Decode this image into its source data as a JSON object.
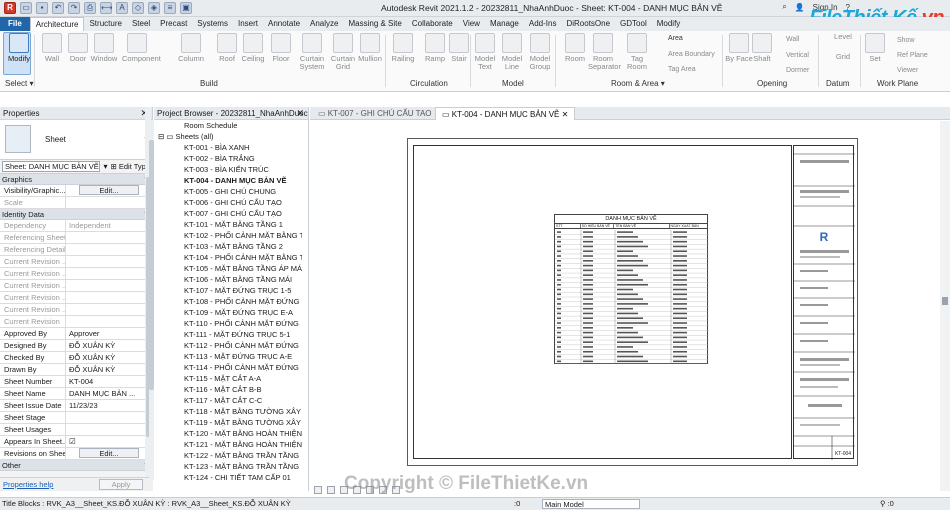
{
  "titlebar": {
    "title": "Autodesk Revit 2021.1.2 - 20232811_NhaAnhDuoc - Sheet: KT-004 - DANH MỤC BẢN VẼ",
    "sign_in": "Sign In",
    "help": "?",
    "logo_text": "File",
    "logo_text2": "Thiết Kế",
    "logo_dot": ".vn"
  },
  "tabs": [
    "File",
    "Architecture",
    "Structure",
    "Steel",
    "Precast",
    "Systems",
    "Insert",
    "Annotate",
    "Analyze",
    "Massing & Site",
    "Collaborate",
    "View",
    "Manage",
    "Add-Ins",
    "DiRootsOne",
    "GDTool",
    "Modify"
  ],
  "ribbon": {
    "tools": [
      {
        "label": "Modify",
        "selected": true
      },
      {
        "label": "Wall"
      },
      {
        "label": "Door"
      },
      {
        "label": "Window"
      },
      {
        "label": "Component"
      },
      {
        "label": "Column"
      },
      {
        "label": "Roof"
      },
      {
        "label": "Ceiling"
      },
      {
        "label": "Floor"
      },
      {
        "label": "Curtain System"
      },
      {
        "label": "Curtain Grid"
      },
      {
        "label": "Mullion"
      },
      {
        "label": "Railing"
      },
      {
        "label": "Ramp"
      },
      {
        "label": "Stair"
      },
      {
        "label": "Model Text"
      },
      {
        "label": "Model Line"
      },
      {
        "label": "Model Group"
      },
      {
        "label": "Room"
      },
      {
        "label": "Room Separator"
      },
      {
        "label": "Tag Room"
      },
      {
        "label": "By Face"
      },
      {
        "label": "Shaft"
      },
      {
        "label": "Level"
      },
      {
        "label": "Grid"
      },
      {
        "label": "Set"
      }
    ],
    "small": [
      "Area",
      "Area Boundary",
      "Tag Area",
      "Wall",
      "Vertical",
      "Dormer",
      "Show",
      "Ref Plane",
      "Viewer"
    ],
    "groups": [
      "Select",
      "Build",
      "Circulation",
      "Model",
      "Room & Area",
      "Opening",
      "Datum",
      "Work Plane"
    ]
  },
  "properties": {
    "title": "Properties",
    "type_name": "Sheet",
    "selector": "Sheet: DANH MỤC BẢN VẼ",
    "edit_type": "Edit Type",
    "groups": {
      "graphics": "Graphics",
      "identity": "Identity Data",
      "other": "Other"
    },
    "graphics_rows": [
      {
        "k": "Visibility/Graphic...",
        "v": "Edit...",
        "btn": true
      },
      {
        "k": "Scale",
        "v": "",
        "grey": true
      }
    ],
    "identity_rows": [
      {
        "k": "Dependency",
        "v": "Independent",
        "grey": true
      },
      {
        "k": "Referencing Sheet",
        "v": "",
        "grey": true
      },
      {
        "k": "Referencing Detail",
        "v": "",
        "grey": true
      },
      {
        "k": "Current Revision ...",
        "v": "",
        "grey": true
      },
      {
        "k": "Current Revision ...",
        "v": "",
        "grey": true
      },
      {
        "k": "Current Revision ...",
        "v": "",
        "grey": true
      },
      {
        "k": "Current Revision ...",
        "v": "",
        "grey": true
      },
      {
        "k": "Current Revision ...",
        "v": "",
        "grey": true
      },
      {
        "k": "Current Revision",
        "v": "",
        "grey": true
      },
      {
        "k": "Approved By",
        "v": "Approver"
      },
      {
        "k": "Designed By",
        "v": "ĐỖ XUÂN KỲ"
      },
      {
        "k": "Checked By",
        "v": "ĐỖ XUÂN KỲ"
      },
      {
        "k": "Drawn By",
        "v": "ĐỖ XUÂN KỲ"
      },
      {
        "k": "Sheet Number",
        "v": "KT-004"
      },
      {
        "k": "Sheet Name",
        "v": "DANH MỤC BẢN ..."
      },
      {
        "k": "Sheet Issue Date",
        "v": "11/23/23"
      },
      {
        "k": "Sheet Stage",
        "v": ""
      },
      {
        "k": "Sheet Usages",
        "v": ""
      },
      {
        "k": "Appears In Sheet...",
        "v": "☑"
      },
      {
        "k": "Revisions on Sheet",
        "v": "Edit...",
        "btn": true
      }
    ],
    "help": "Properties help",
    "apply": "Apply"
  },
  "project_browser": {
    "title": "Project Browser - 20232811_NhaAnhDuoc",
    "items": [
      {
        "label": "Room Schedule",
        "indent": 1
      },
      {
        "label": "Sheets (all)",
        "indent": 0,
        "folder": true
      },
      {
        "label": "KT-001 - BÌA XANH",
        "indent": 2
      },
      {
        "label": "KT-002 - BÌA TRẮNG",
        "indent": 2
      },
      {
        "label": "KT-003 - BÌA KIẾN TRÚC",
        "indent": 2
      },
      {
        "label": "KT-004 - DANH MỤC BẢN VẼ",
        "indent": 2,
        "selected": true
      },
      {
        "label": "KT-005 - GHI CHÚ CHUNG",
        "indent": 2
      },
      {
        "label": "KT-006 - GHI CHÚ CẤU TẠO",
        "indent": 2
      },
      {
        "label": "KT-007 - GHI CHÚ CẤU TẠO",
        "indent": 2
      },
      {
        "label": "KT-101 - MẶT BẰNG TẦNG 1",
        "indent": 2
      },
      {
        "label": "KT-102 - PHỐI CẢNH MẶT BẰNG T",
        "indent": 2
      },
      {
        "label": "KT-103 - MẶT BẰNG TẦNG 2",
        "indent": 2
      },
      {
        "label": "KT-104 - PHỐI CẢNH MẶT BẰNG T",
        "indent": 2
      },
      {
        "label": "KT-105 - MẶT BẰNG TẦNG ÁP MÁ",
        "indent": 2
      },
      {
        "label": "KT-106 - MẶT BẰNG TẦNG MÁI",
        "indent": 2
      },
      {
        "label": "KT-107 - MẶT ĐỨNG TRỤC 1-5",
        "indent": 2
      },
      {
        "label": "KT-108 - PHỐI CẢNH MẶT ĐỨNG",
        "indent": 2
      },
      {
        "label": "KT-109 - MẶT ĐỨNG TRỤC E-A",
        "indent": 2
      },
      {
        "label": "KT-110 - PHỐI CẢNH MẶT ĐỨNG",
        "indent": 2
      },
      {
        "label": "KT-111 - MẶT ĐỨNG TRỤC 5-1",
        "indent": 2
      },
      {
        "label": "KT-112 - PHỐI CẢNH MẶT ĐỨNG",
        "indent": 2
      },
      {
        "label": "KT-113 - MẶT ĐỨNG TRỤC A-E",
        "indent": 2
      },
      {
        "label": "KT-114 - PHỐI CẢNH MẶT ĐỨNG",
        "indent": 2
      },
      {
        "label": "KT-115 - MẶT CẮT A-A",
        "indent": 2
      },
      {
        "label": "KT-116 - MẶT CẮT B-B",
        "indent": 2
      },
      {
        "label": "KT-117 - MẶT CẮT C-C",
        "indent": 2
      },
      {
        "label": "KT-118 - MẶT BẰNG TƯỜNG XÂY T",
        "indent": 2
      },
      {
        "label": "KT-119 - MẶT BẰNG TƯỜNG XÂY",
        "indent": 2
      },
      {
        "label": "KT-120 - MẶT BẰNG HOÀN THIỆN",
        "indent": 2
      },
      {
        "label": "KT-121 - MẶT BẰNG HOÀN THIỆN",
        "indent": 2
      },
      {
        "label": "KT-122 - MẶT BẰNG TRẦN TẦNG",
        "indent": 2
      },
      {
        "label": "KT-123 - MẶT BẰNG TRẦN TẦNG",
        "indent": 2
      },
      {
        "label": "KT-124 - CHI TIẾT TAM CẤP 01",
        "indent": 2
      }
    ]
  },
  "view_tabs": [
    {
      "label": "KT-007 - GHI CHÚ CẤU TAO",
      "active": false
    },
    {
      "label": "KT-004 - DANH MỤC BẢN VẼ",
      "active": true
    }
  ],
  "drawing": {
    "schedule_title": "DANH MỤC BẢN VẼ",
    "schedule_headers": [
      "STT",
      "SỐ HIỆU BẢN VẼ",
      "TÊN BẢN VẼ",
      "NGÀY XUẤT BẢN"
    ],
    "sheet_number": "KT-004"
  },
  "watermark": "Copyright © FileThietKe.vn",
  "statusbar": {
    "text": "Title Blocks : RVK_A3__Sheet_KS.ĐỖ XUÂN KỲ : RVK_A3__Sheet_KS.ĐỖ XUÂN KỲ",
    "zero": ":0",
    "model": "Main Model"
  }
}
